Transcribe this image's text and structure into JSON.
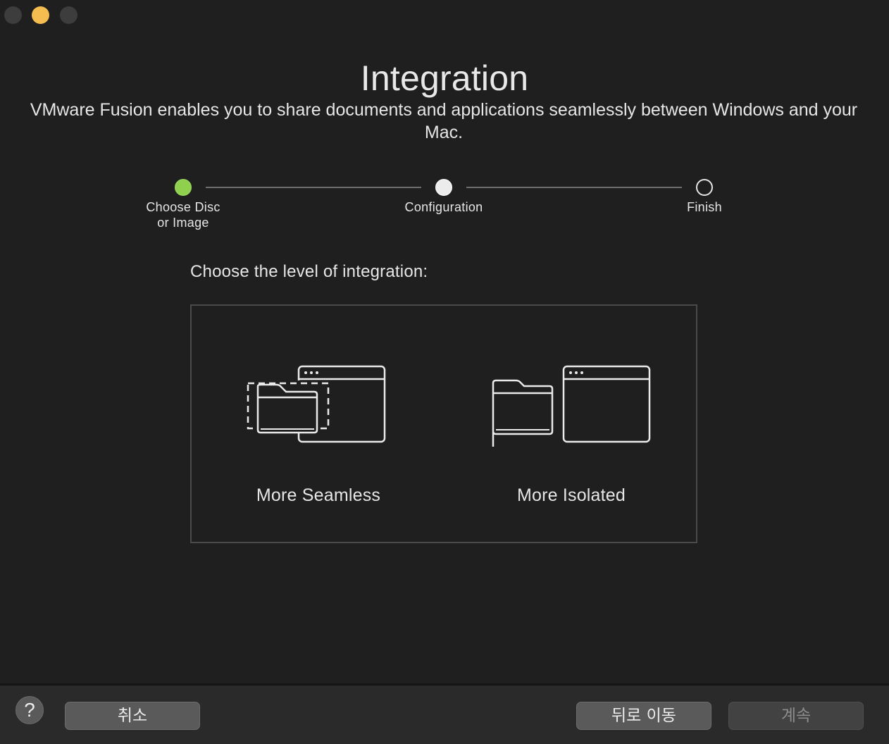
{
  "window": {
    "controls": {
      "close": "close-button",
      "minimize": "minimize-button",
      "zoom": "zoom-button"
    }
  },
  "header": {
    "title": "Integration",
    "subtitle": "VMware Fusion enables you to share documents and applications seamlessly between Windows and your Mac."
  },
  "steps": [
    {
      "label": "Choose Disc\nor Image",
      "state": "complete",
      "color": "#8fd14f"
    },
    {
      "label": "Configuration",
      "state": "current",
      "color": "#ececec"
    },
    {
      "label": "Finish",
      "state": "pending",
      "color": "#e6e6e6"
    }
  ],
  "main": {
    "heading": "Choose the level of integration:",
    "options": [
      {
        "label": "More Seamless",
        "icon": "shared-folder-window-icon"
      },
      {
        "label": "More Isolated",
        "icon": "separate-folder-window-icon"
      }
    ]
  },
  "footer": {
    "help_label": "?",
    "cancel_label": "취소",
    "back_label": "뒤로 이동",
    "continue_label": "계속"
  },
  "colors": {
    "background": "#1f1f1f",
    "accent_complete": "#8fd14f",
    "minimize": "#f5bd4f"
  }
}
